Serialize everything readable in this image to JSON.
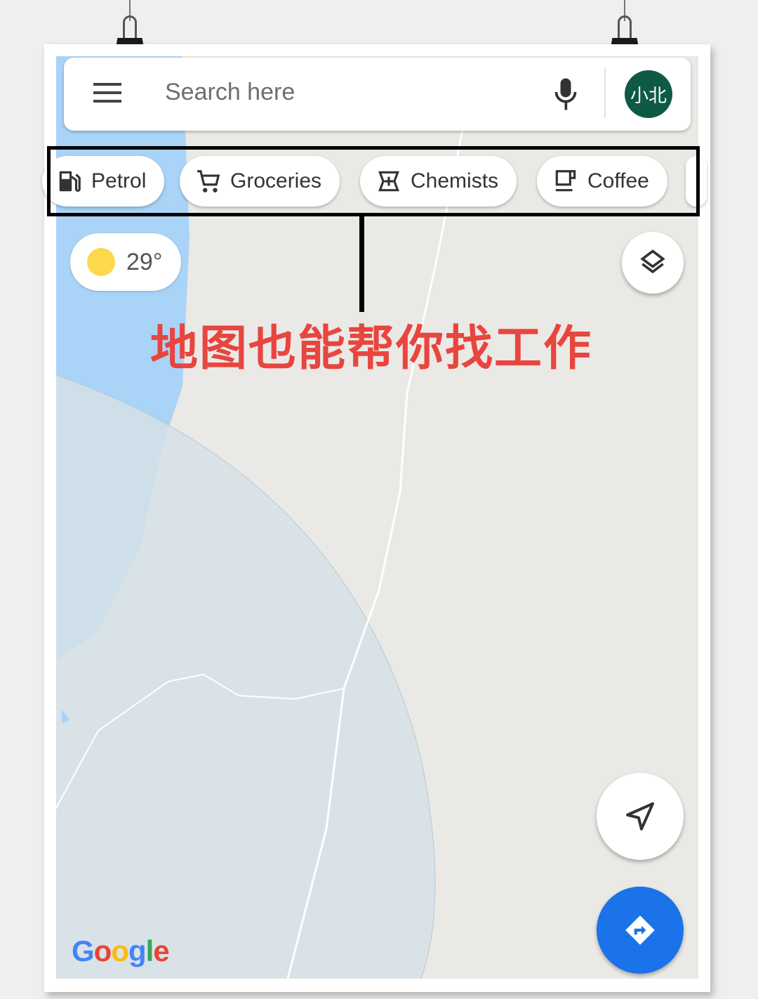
{
  "search": {
    "placeholder": "Search here",
    "avatar_text": "小北"
  },
  "chips": [
    {
      "label": "Petrol",
      "icon": "fuel-pump-icon"
    },
    {
      "label": "Groceries",
      "icon": "cart-icon"
    },
    {
      "label": "Chemists",
      "icon": "pharmacy-icon"
    },
    {
      "label": "Coffee",
      "icon": "coffee-cup-icon"
    }
  ],
  "weather": {
    "temperature": "29°",
    "icon": "sun-icon"
  },
  "annotation": {
    "text": "地图也能帮你找工作",
    "color": "#e8453f"
  },
  "logo": {
    "text": "Google"
  },
  "colors": {
    "accent": "#1a73e8",
    "avatar": "#0f5a45",
    "water": "#a9d4f7",
    "map": "#ebe9e5"
  }
}
